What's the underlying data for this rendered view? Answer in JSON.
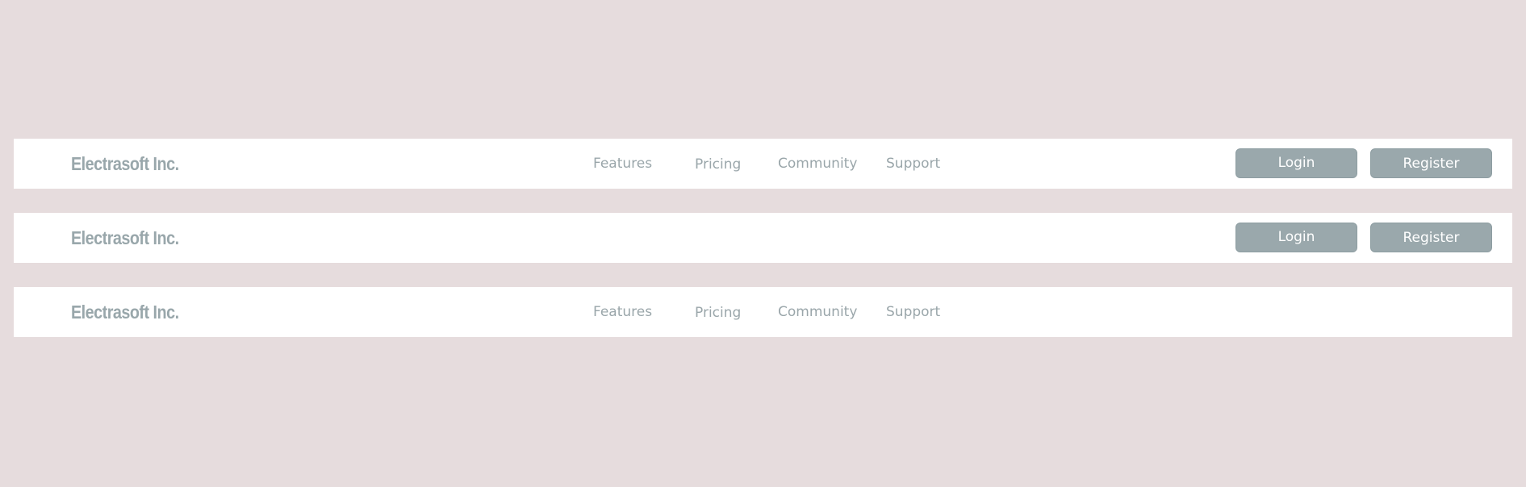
{
  "navbars": [
    {
      "brand": "Electrasoft Inc.",
      "links": [
        "Features",
        "Pricing",
        "Community",
        "Support"
      ],
      "buttons": {
        "login": "Login",
        "register": "Register"
      }
    },
    {
      "brand": "Electrasoft Inc.",
      "buttons": {
        "login": "Login",
        "register": "Register"
      }
    },
    {
      "brand": "Electrasoft Inc.",
      "links": [
        "Features",
        "Pricing",
        "Community",
        "Support"
      ]
    }
  ],
  "colors": {
    "page_background": "#e6dcdd",
    "navbar_background": "#ffffff",
    "brand_text": "#99a7ab",
    "link_text": "#9aa6aa",
    "button_background": "#9aa8ac",
    "button_text": "#ffffff"
  }
}
